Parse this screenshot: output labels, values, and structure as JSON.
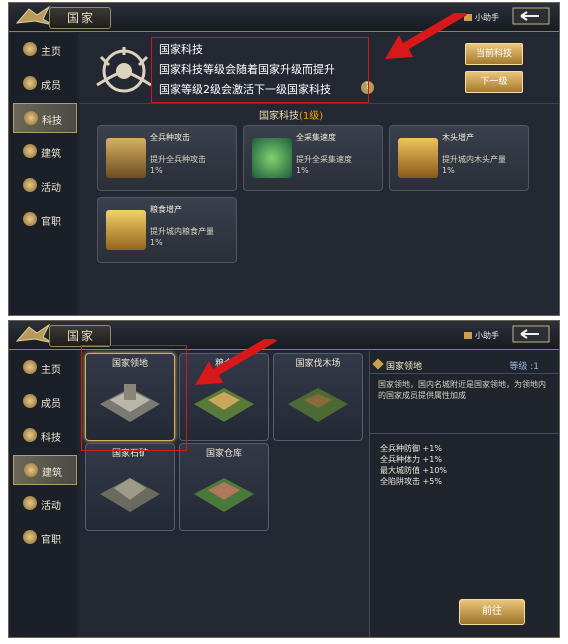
{
  "top": {
    "title": "国家",
    "helper": "小助手",
    "sidebar": [
      "主页",
      "成员",
      "科技",
      "建筑",
      "活动",
      "官职"
    ],
    "active_tab": "科技",
    "header": {
      "name": "国家科技",
      "line1": "国家科技等级会随着国家升级而提升",
      "line2": "国家等级2级会激活下一级国家科技",
      "help_icon": "?"
    },
    "buttons": {
      "current": "当前科技",
      "next": "下一级"
    },
    "section": {
      "label": "国家科技",
      "level": "(1级)"
    },
    "techs": [
      {
        "name": "全兵种攻击",
        "desc": "提升全兵种攻击",
        "value": "1%"
      },
      {
        "name": "全采集速度",
        "desc": "提升全采集速度",
        "value": "1%"
      },
      {
        "name": "木头增产",
        "desc": "提升城内木头产量",
        "value": "1%"
      },
      {
        "name": "粮食增产",
        "desc": "提升城内粮食产量",
        "value": "1%"
      }
    ]
  },
  "bottom": {
    "title": "国家",
    "helper": "小助手",
    "sidebar": [
      "主页",
      "成员",
      "科技",
      "建筑",
      "活动",
      "官职"
    ],
    "active_tab": "建筑",
    "buildings": [
      "国家领地",
      "粮仓",
      "国家伐木场",
      "国家石矿",
      "国家仓库"
    ],
    "detail": {
      "name": "国家领地",
      "level": "等级 :1",
      "desc": "国家领地，国内名城附近是国家领地，为领地内的国家成员提供属性加成",
      "bonuses": [
        "全兵种防御 +1%",
        "全兵种体力 +1%",
        "最大城防值 +10%",
        "全陷阱攻击 +5%"
      ]
    },
    "goto": "前往"
  },
  "colors": {
    "accent_gold": "#e9c67a",
    "highlight_red": "#d01a1a",
    "level_orange": "#f4a300"
  }
}
